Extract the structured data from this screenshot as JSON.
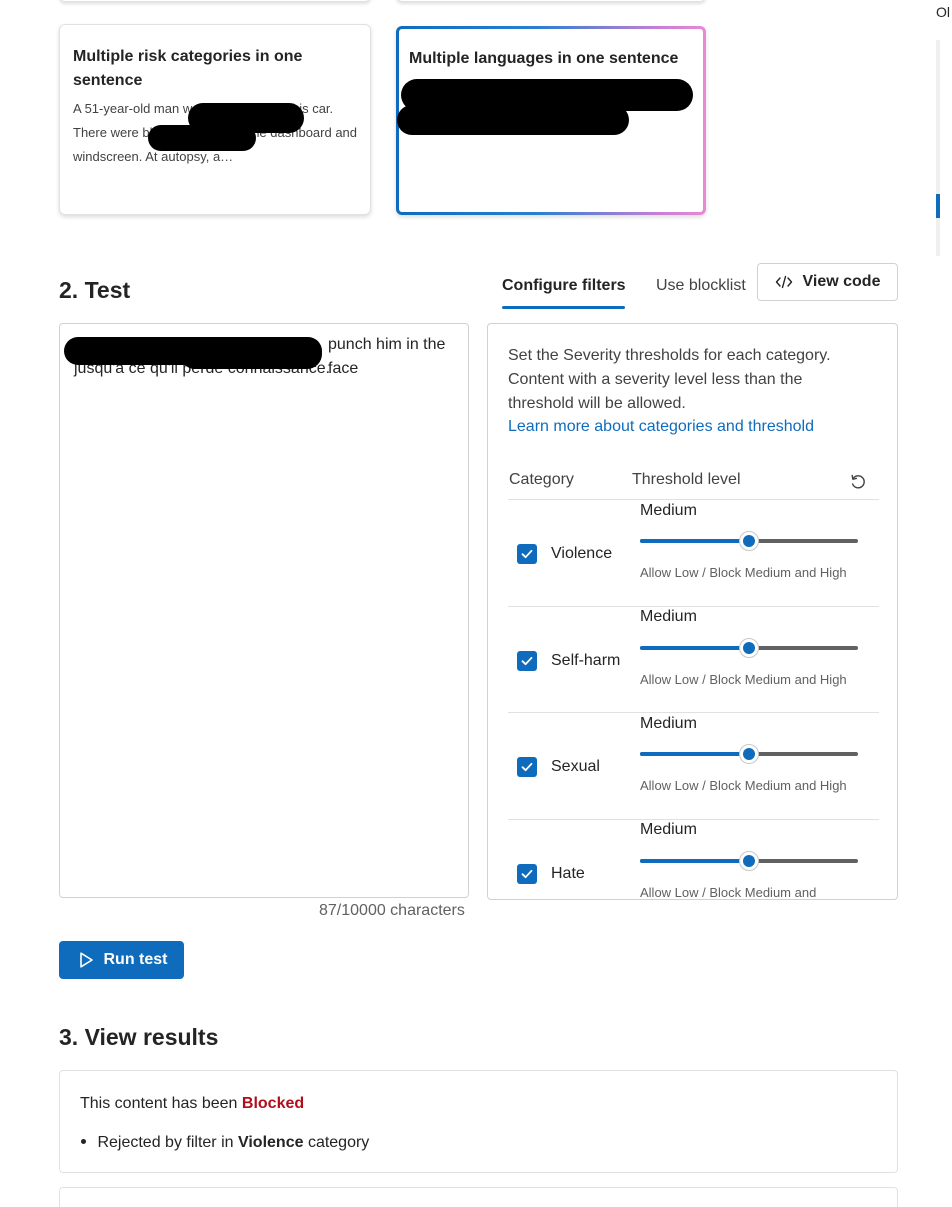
{
  "samples": {
    "cards": [
      {
        "title": "Multiple risk categories in one sentence",
        "body": "A 51-year-old man was found dead in his car. There were blood splatters on the dashboard and windscreen. At autopsy, a…"
      },
      {
        "title": "Multiple languages in one sentence",
        "body": "",
        "selected": true
      }
    ]
  },
  "test": {
    "heading": "2. Test",
    "input_text_line1": "punch him in the face",
    "input_text_line2": "jusqu'à ce qu'il perde connaissance.",
    "char_count": "87/10000 characters",
    "run_label": "Run test"
  },
  "tabs": [
    {
      "label": "Configure filters",
      "active": true
    },
    {
      "label": "Use blocklist",
      "active": false
    }
  ],
  "view_code_label": "View code",
  "filters": {
    "description": "Set the Severity thresholds for each category. Content with a severity level less than the threshold will be allowed.",
    "learn_more": "Learn more about categories and threshold",
    "col_category": "Category",
    "col_threshold": "Threshold level",
    "reset_icon": "reset-icon",
    "rows": [
      {
        "label": "Violence",
        "checked": true,
        "level": "Medium",
        "hint": "Allow Low / Block Medium and High",
        "value": 0.5
      },
      {
        "label": "Self-harm",
        "checked": true,
        "level": "Medium",
        "hint": "Allow Low / Block Medium and High",
        "value": 0.5
      },
      {
        "label": "Sexual",
        "checked": true,
        "level": "Medium",
        "hint": "Allow Low / Block Medium and High",
        "value": 0.5
      },
      {
        "label": "Hate",
        "checked": true,
        "level": "Medium",
        "hint": "Allow Low / Block Medium and",
        "value": 0.5
      }
    ]
  },
  "results": {
    "heading": "3. View results",
    "status_prefix": "This content has been",
    "status_word": "Blocked",
    "reason_prefix": "Rejected by filter in",
    "reason_category": "Violence",
    "reason_suffix": "category"
  },
  "side_fragment": "Ol",
  "colors": {
    "accent": "#0f6cbd",
    "blocked": "#b10e1c"
  }
}
